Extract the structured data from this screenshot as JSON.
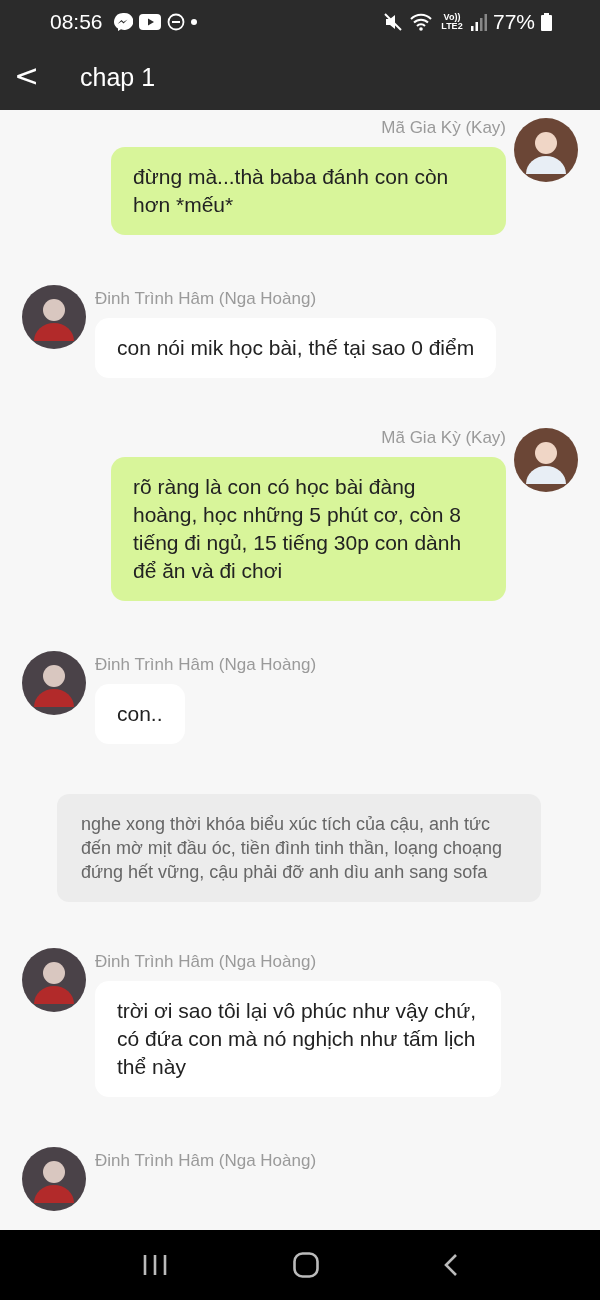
{
  "status_bar": {
    "time": "08:56",
    "network_label": "Vo)) LTE2",
    "battery": "77%"
  },
  "header": {
    "back": "<",
    "title": "chap 1"
  },
  "messages": [
    {
      "kind": "sent",
      "sender": "Mã Gia Kỳ (Kay)",
      "text": "đừng mà...thà baba đánh con còn hơn *mếu*"
    },
    {
      "kind": "received",
      "sender": "Đinh Trình Hâm (Nga Hoàng)",
      "text": "con nói mik học bài, thế tại sao 0 điểm"
    },
    {
      "kind": "sent",
      "sender": "Mã Gia Kỳ (Kay)",
      "text": "rõ ràng là con có học bài đàng hoàng, học những 5 phút cơ, còn 8 tiếng đi ngủ, 15 tiếng 30p con dành để ăn và đi chơi"
    },
    {
      "kind": "received",
      "sender": "Đinh Trình Hâm (Nga Hoàng)",
      "text": "con.."
    },
    {
      "kind": "narration",
      "text": "nghe xong thời khóa biểu xúc tích của cậu, anh tức đến mờ mịt đầu óc, tiền đình tinh thần, loạng choạng đứng hết vững, cậu phải đỡ anh dìu anh sang sofa"
    },
    {
      "kind": "received",
      "sender": "Đinh Trình Hâm (Nga Hoàng)",
      "text": "trời ơi sao tôi lại vô phúc như vậy chứ, có đứa con mà nó nghịch như tấm lịch thể này"
    },
    {
      "kind": "received",
      "sender": "Đinh Trình Hâm (Nga Hoàng)"
    }
  ]
}
